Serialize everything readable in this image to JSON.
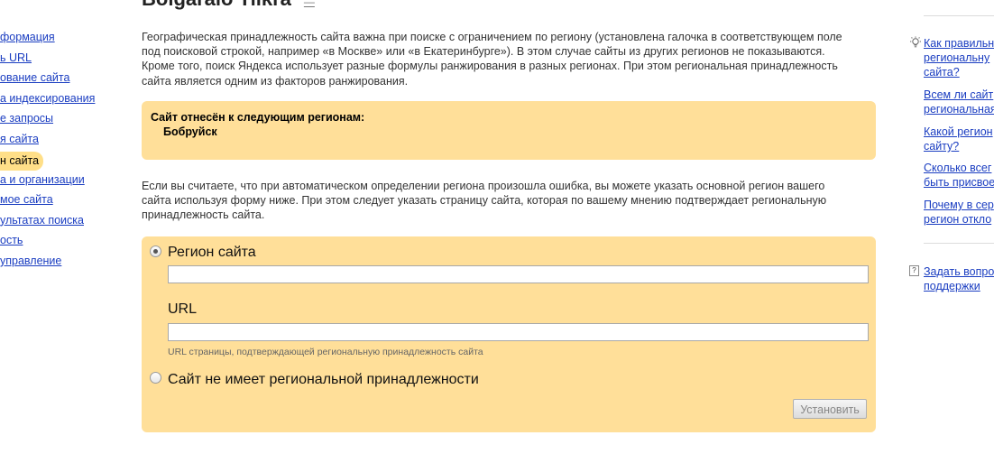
{
  "header": {
    "title": "Bolgaraio Tilkra",
    "sub": "—"
  },
  "sidebar": {
    "items": [
      {
        "label": "формация"
      },
      {
        "label": "ь URL"
      },
      {
        "label": "ование сайта"
      },
      {
        "label": "а индексирования"
      },
      {
        "label": "е запросы"
      },
      {
        "label": "я сайта"
      },
      {
        "label": "н сайта"
      },
      {
        "label": "а и организации"
      },
      {
        "label": "мое сайта"
      },
      {
        "label": "ультатах поиска"
      },
      {
        "label": "ость"
      },
      {
        "label": "управление"
      }
    ],
    "active_index": 6
  },
  "intro": {
    "lines": [
      "Географическая принадлежность сайта важна при поиске с ограничением по региону (установлена галочка в соответствующем поле",
      "под поисковой строкой, например «в Москве» или «в Екатеринбурге»). В этом случае сайты из других регионов не показываются.",
      "Кроме того, поиск Яндекса использует разные формулы ранжирования в разных регионах. При этом региональная принадлежность",
      "сайта является одним из факторов ранжирования."
    ]
  },
  "region_box": {
    "title": "Сайт отнесён к следующим регионам:",
    "value": "Бобруйск"
  },
  "notice": {
    "lines": [
      "Если вы считаете, что при автоматическом определении региона произошла ошибка, вы можете указать основной регион вашего",
      "сайта используя форму ниже. При этом следует указать страницу сайта, которая по вашему мнению подтверждает региональную",
      "принадлежность сайта."
    ]
  },
  "form": {
    "region_label": "Регион сайта",
    "region_value": "",
    "url_label": "URL",
    "url_value": "",
    "url_hint": "URL страницы, подтверждающей региональную принадлежность сайта",
    "no_region_label": "Сайт не имеет региональной принадлежности",
    "submit_label": "Установить"
  },
  "help": {
    "links": [
      {
        "lines": [
          "Как правильн",
          "региональну",
          "сайта?"
        ]
      },
      {
        "lines": [
          "Всем ли сайт",
          "региональная"
        ]
      },
      {
        "lines": [
          "Какой регион",
          "сайту?"
        ]
      },
      {
        "lines": [
          "Сколько всег",
          "быть присвое"
        ]
      },
      {
        "lines": [
          "Почему в сер",
          "регион откло"
        ]
      }
    ],
    "support": {
      "lines": [
        "Задать вопрос",
        "поддержки"
      ]
    },
    "support_icon": "?"
  },
  "colors": {
    "accent": "#ffdf99",
    "link": "#1a3dc1"
  }
}
